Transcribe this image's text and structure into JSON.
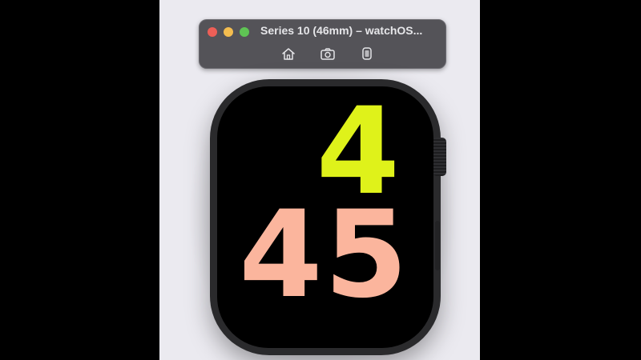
{
  "window": {
    "title": "Series 10 (46mm) – watchOS...",
    "toolbar": [
      {
        "icon": "home-icon"
      },
      {
        "icon": "screenshot-icon"
      },
      {
        "icon": "rotate-device-icon"
      }
    ]
  },
  "watch_face": {
    "hour": "4",
    "minutes": "45",
    "hour_color": "#dff21a",
    "minutes_color": "#fbb59d"
  }
}
